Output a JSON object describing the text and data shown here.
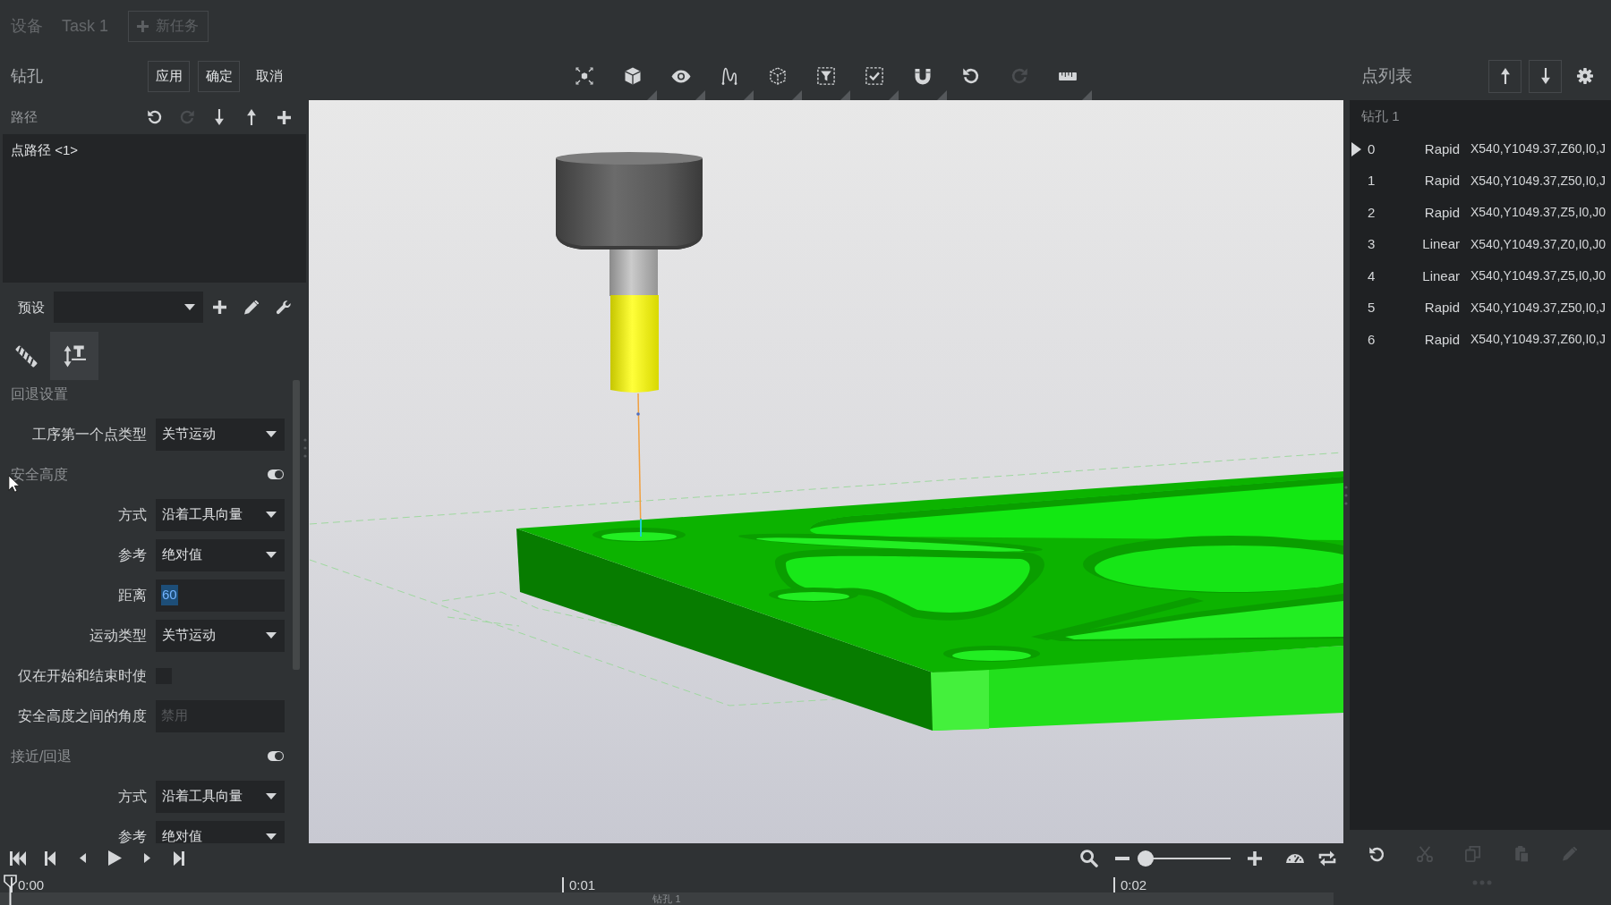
{
  "top_bar": {
    "tabs": [
      {
        "label": "设备",
        "selected": false
      },
      {
        "label": "Task 1",
        "selected": false
      }
    ],
    "new_task_button": {
      "label": "新任务",
      "disabled": true
    }
  },
  "operation_panel": {
    "title": "钻孔",
    "buttons": [
      {
        "label": "应用",
        "kind": "outlined"
      },
      {
        "label": "确定",
        "kind": "outlined"
      },
      {
        "label": "取消",
        "kind": "plain"
      }
    ],
    "path": {
      "label": "路径",
      "tools": [
        {
          "disabled": false
        },
        {
          "disabled": true
        },
        {
          "disabled": false
        },
        {
          "disabled": false
        },
        {
          "disabled": false
        }
      ],
      "items": [
        {
          "label": "点路径 <1>",
          "selected": false
        }
      ]
    },
    "preset": {
      "label": "预设"
    },
    "mode_tabs": [
      {
        "selected": false
      },
      {
        "selected": true
      }
    ],
    "form": [
      {
        "kind": "heading",
        "label": "回退设置"
      },
      {
        "kind": "select",
        "label": "工序第一个点类型",
        "value": "关节运动"
      },
      {
        "kind": "toggle_heading",
        "label": "安全高度",
        "on": true
      },
      {
        "kind": "select",
        "label": "方式",
        "value": "沿着工具向量"
      },
      {
        "kind": "select",
        "label": "参考",
        "value": "绝对值"
      },
      {
        "kind": "text_input",
        "label": "距离",
        "value": "60",
        "text_selected": true
      },
      {
        "kind": "select",
        "label": "运动类型",
        "value": "关节运动"
      },
      {
        "kind": "checkbox",
        "label": "仅在开始和结束时使",
        "checked": false
      },
      {
        "kind": "text_input",
        "label": "安全高度之间的角度",
        "placeholder": "禁用"
      },
      {
        "kind": "toggle_heading",
        "label": "接近/回退",
        "on": true
      },
      {
        "kind": "select",
        "label": "方式",
        "value": "沿着工具向量"
      },
      {
        "kind": "select",
        "label": "参考",
        "value": "绝对值"
      }
    ]
  },
  "viewport_toolbar": [
    {
      "disabled": false,
      "has_menu": false
    },
    {
      "disabled": false,
      "has_menu": true
    },
    {
      "disabled": false,
      "has_menu": true
    },
    {
      "disabled": false,
      "has_menu": true
    },
    {
      "disabled": false,
      "has_menu": true
    },
    {
      "disabled": false,
      "has_menu": true
    },
    {
      "disabled": false,
      "has_menu": true
    },
    {
      "disabled": false,
      "has_menu": true
    },
    {
      "disabled": false,
      "has_menu": false
    },
    {
      "disabled": true,
      "has_menu": false
    },
    {
      "disabled": false,
      "has_menu": true
    }
  ],
  "playback": {
    "zoom_slider": {
      "level": 0
    }
  },
  "timeline": {
    "ticks": [
      "0:00",
      "0:01",
      "0:02"
    ],
    "track_label": "钻孔 1"
  },
  "point_list": {
    "title": "点列表",
    "group": "钻孔 1",
    "rows": [
      {
        "index": "0",
        "type": "Rapid",
        "coords": "X540,Y1049.37,Z60,I0,J",
        "current": true
      },
      {
        "index": "1",
        "type": "Rapid",
        "coords": "X540,Y1049.37,Z50,I0,J",
        "current": false
      },
      {
        "index": "2",
        "type": "Rapid",
        "coords": "X540,Y1049.37,Z5,I0,J0",
        "current": false
      },
      {
        "index": "3",
        "type": "Linear",
        "coords": "X540,Y1049.37,Z0,I0,J0",
        "current": false
      },
      {
        "index": "4",
        "type": "Linear",
        "coords": "X540,Y1049.37,Z5,I0,J0",
        "current": false
      },
      {
        "index": "5",
        "type": "Rapid",
        "coords": "X540,Y1049.37,Z50,I0,J",
        "current": false
      },
      {
        "index": "6",
        "type": "Rapid",
        "coords": "X540,Y1049.37,Z60,I0,J",
        "current": false
      }
    ],
    "actions": [
      {
        "disabled": false
      },
      {
        "disabled": true
      },
      {
        "disabled": true
      },
      {
        "disabled": true
      },
      {
        "disabled": true
      }
    ]
  }
}
